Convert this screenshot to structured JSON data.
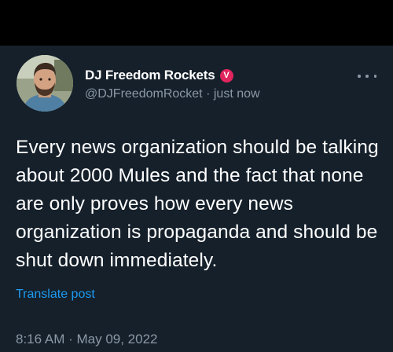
{
  "author": {
    "display_name": "DJ Freedom Rockets",
    "badge_icon": "v-badge-icon",
    "badge_glyph": "V",
    "handle": "@DJFreedomRocket",
    "separator": "·",
    "relative_time": "just now"
  },
  "menu": {
    "icon": "more-options-icon"
  },
  "tweet": {
    "text": "Every news organization should be talking about 2000 Mules and the fact that none are only proves how every news organization is propaganda and should be shut down immediately.",
    "translate_label": "Translate post",
    "timestamp": "8:16 AM · May 09, 2022"
  },
  "colors": {
    "background": "#15202b",
    "top_bar": "#000000",
    "text_primary": "#ffffff",
    "text_secondary": "#8b98a5",
    "link": "#1d9bf0",
    "badge": "#e0245e"
  }
}
